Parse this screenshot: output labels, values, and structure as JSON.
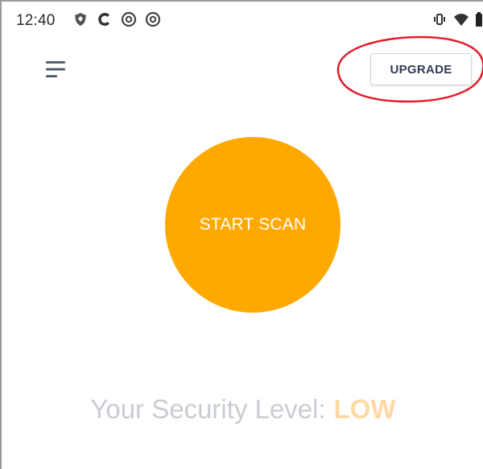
{
  "status_bar": {
    "time": "12:40",
    "left_icons": [
      "shield-status-icon",
      "c-app-icon",
      "at-sign-icon",
      "at-sign-icon"
    ],
    "right_icons": [
      "vibrate-icon",
      "wifi-icon",
      "battery-icon"
    ]
  },
  "app_bar": {
    "menu_icon": "hamburger-menu-icon",
    "upgrade_label": "UPGRADE"
  },
  "scan": {
    "label": "START SCAN",
    "color": "#ffa800"
  },
  "security": {
    "label": "Your Security Level:",
    "value": "LOW",
    "value_color": "#ffd9a3"
  },
  "annotation": {
    "color": "#e11d2a"
  }
}
